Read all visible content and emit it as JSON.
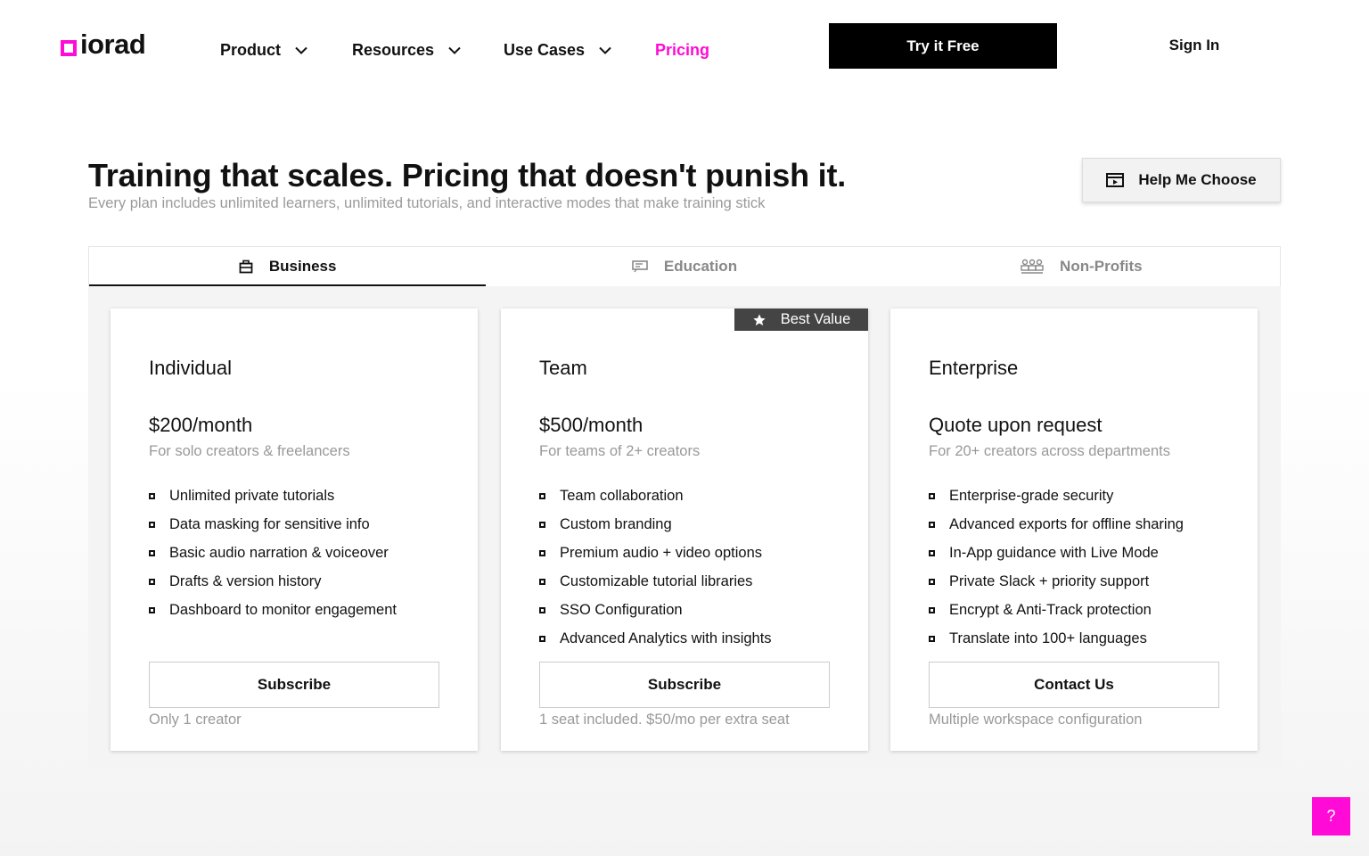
{
  "brand": {
    "logo_text": "iorad",
    "accent_color": "#ff0ad6"
  },
  "nav": {
    "items": [
      {
        "label": "Product",
        "has_dropdown": true
      },
      {
        "label": "Resources",
        "has_dropdown": true
      },
      {
        "label": "Use Cases",
        "has_dropdown": true
      },
      {
        "label": "Pricing",
        "active": true
      }
    ],
    "try_label": "Try it Free",
    "signin_label": "Sign In"
  },
  "hero": {
    "title": "Training that scales. Pricing that doesn't punish it.",
    "subtitle": "Every plan includes unlimited learners, unlimited tutorials, and interactive modes that make training stick",
    "help_label": "Help Me Choose",
    "help_icon": "play-window-icon"
  },
  "tabs": [
    {
      "label": "Business",
      "icon": "briefcase-icon",
      "active": true
    },
    {
      "label": "Education",
      "icon": "whiteboard-icon"
    },
    {
      "label": "Non-Profits",
      "icon": "people-group-icon"
    }
  ],
  "plans": [
    {
      "name": "Individual",
      "price": "$200/month",
      "desc": "For solo creators & freelancers",
      "features": [
        "Unlimited private tutorials",
        "Data masking for sensitive info",
        "Basic audio narration & voiceover",
        "Drafts & version history",
        "Dashboard to monitor engagement"
      ],
      "button": "Subscribe",
      "footnote": "Only 1 creator"
    },
    {
      "name": "Team",
      "price": "$500/month",
      "desc": "For teams of 2+ creators",
      "badge": "Best Value",
      "features": [
        "Team collaboration",
        "Custom branding",
        "Premium audio + video options",
        "Customizable tutorial libraries",
        "SSO Configuration",
        "Advanced Analytics with insights"
      ],
      "button": "Subscribe",
      "footnote": "1 seat included. $50/mo per extra seat"
    },
    {
      "name": "Enterprise",
      "price": "Quote upon request",
      "desc": "For 20+ creators across departments",
      "features": [
        "Enterprise-grade security",
        "Advanced exports for offline sharing",
        "In-App guidance with Live Mode",
        "Private Slack + priority support",
        "Encrypt & Anti-Track protection",
        "Translate into 100+ languages"
      ],
      "button": "Contact Us",
      "footnote": "Multiple workspace configuration"
    }
  ],
  "help_fab": {
    "label": "?"
  }
}
